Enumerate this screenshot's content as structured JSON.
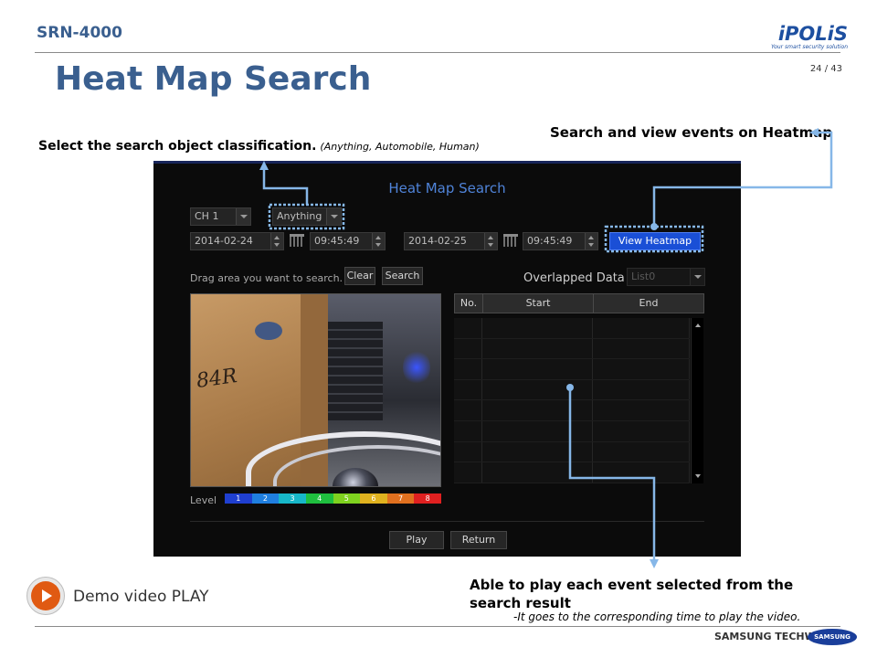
{
  "slide": {
    "product": "SRN-4000",
    "logo": {
      "main": "iPOLiS",
      "tagline": "Your smart security solution"
    },
    "page": "24 / 43",
    "title": "Heat Map Search"
  },
  "annotations": {
    "top_right": "Search and view events on Heatmap",
    "top_left": "Select the search object classification.",
    "top_left_note": "(Anything,  Automobile,  Human)",
    "bottom": "Able to play each event selected from the search result",
    "bottom_note": "-It goes to the corresponding  time to play the video."
  },
  "demo": {
    "label": "Demo video PLAY",
    "icon": "play-icon"
  },
  "footer": {
    "brand": "SAMSUNG TECHWIN",
    "badge": "SAMSUNG"
  },
  "dialog": {
    "title": "Heat Map Search",
    "channel": "CH 1",
    "object_class": "Anything",
    "start_date": "2014-02-24",
    "start_time": "09:45:49",
    "end_date": "2014-02-25",
    "end_time": "09:45:49",
    "view_heatmap": "View Heatmap",
    "drag_hint": "Drag area you want to search.",
    "clear": "Clear",
    "search": "Search",
    "overlapped_label": "Overlapped Data",
    "overlapped_value": "List0",
    "feed_scrawl": "84R",
    "level_label": "Level",
    "levels": [
      {
        "label": "1",
        "color": "#1f3fd0"
      },
      {
        "label": "2",
        "color": "#1f7fe0"
      },
      {
        "label": "3",
        "color": "#17b7c9"
      },
      {
        "label": "4",
        "color": "#1fbf3f"
      },
      {
        "label": "5",
        "color": "#7fd21f"
      },
      {
        "label": "6",
        "color": "#e0b21f"
      },
      {
        "label": "7",
        "color": "#e0701f"
      },
      {
        "label": "8",
        "color": "#e02020"
      }
    ],
    "table": {
      "columns": [
        "No.",
        "Start",
        "End"
      ],
      "row_count": 8
    },
    "play": "Play",
    "return": "Return"
  },
  "colors": {
    "title": "#3a5f8f",
    "highlight": "#86b7e8",
    "accent_button": "#1a4fd6"
  }
}
